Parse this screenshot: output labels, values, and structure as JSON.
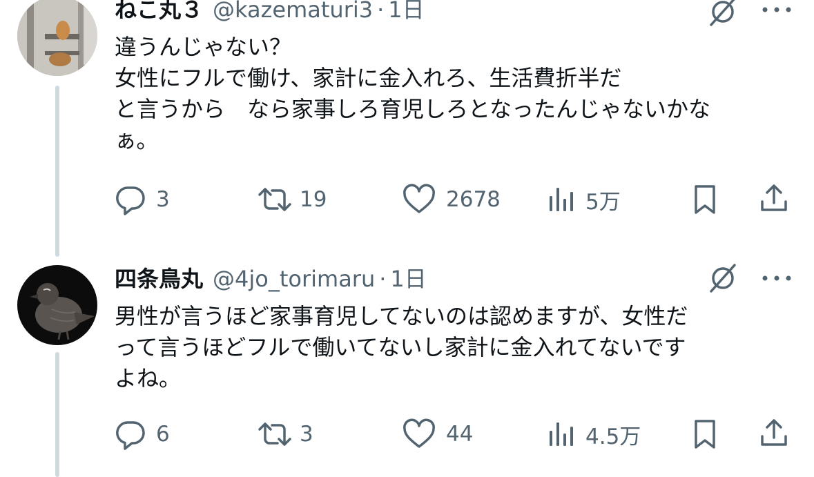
{
  "tweets": [
    {
      "name": "ねこ丸３",
      "handle": "@kazematuri3",
      "separator": "·",
      "time": "1日",
      "body": "違うんじゃない？\n女性にフルで働け、家計に金入れろ、生活費折半だ\nと言うから　なら家事しろ育児しろとなったんじゃないかな\nぁ。",
      "stats": {
        "replies": "3",
        "reposts": "19",
        "likes": "2678",
        "views": "5万"
      }
    },
    {
      "name": "四条鳥丸",
      "handle": "@4jo_torimaru",
      "separator": "·",
      "time": "1日",
      "body": "男性が言うほど家事育児してないのは認めますが、女性だ\nって言うほどフルで働いてないし家計に金入れてないです\nよね。",
      "stats": {
        "replies": "6",
        "reposts": "3",
        "likes": "44",
        "views": "4.5万"
      }
    }
  ],
  "icons": {
    "reply": "reply-icon",
    "repost": "repost-icon",
    "like": "heart-icon",
    "views": "views-icon",
    "bookmark": "bookmark-icon",
    "share": "share-icon",
    "grok": "grok-icon",
    "more": "more-icon"
  },
  "colors": {
    "text": "#0f1419",
    "secondary": "#536471",
    "thread_line": "#cfd9de",
    "background": "#ffffff"
  }
}
